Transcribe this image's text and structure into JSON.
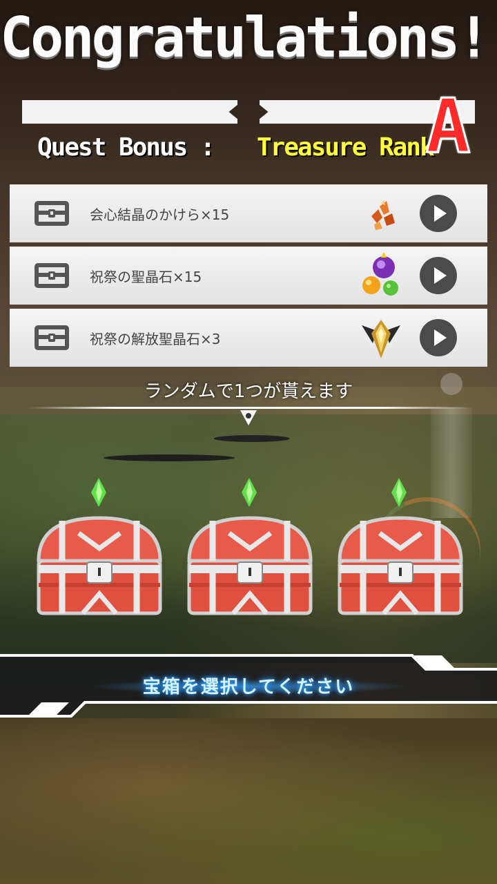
{
  "header": {
    "title": "Congratulations!!",
    "quest_bonus_label": "Quest Bonus :",
    "treasure_rank_label": "Treasure Rank",
    "rank": "A"
  },
  "rewards": [
    {
      "name": "会心結晶のかけら×15",
      "icon": "crystal-shards-icon"
    },
    {
      "name": "祝祭の聖晶石×15",
      "icon": "festival-crystal-icon"
    },
    {
      "name": "祝祭の解放聖晶石×3",
      "icon": "release-crystal-icon"
    }
  ],
  "random_note": "ランダムで1つが貰えます",
  "chests": [
    {
      "icon": "treasure-chest-icon"
    },
    {
      "icon": "treasure-chest-icon"
    },
    {
      "icon": "treasure-chest-icon"
    }
  ],
  "select_prompt": "宝箱を選択してください",
  "colors": {
    "rank": "#ff2a2a",
    "treasure_rank_text": "#ffff3a",
    "chest_body": "#e85a4a",
    "gem": "#5fe04a",
    "prompt_glow": "#2aa8ff"
  }
}
